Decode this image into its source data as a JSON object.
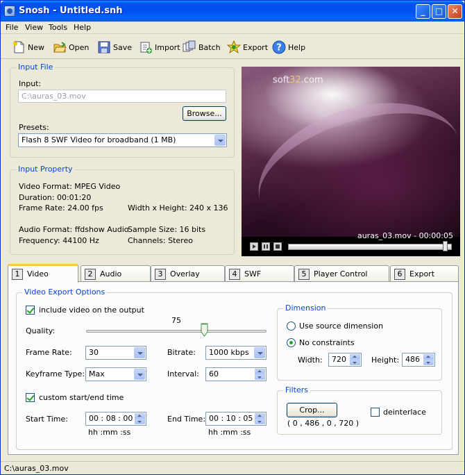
{
  "window": {
    "title": "Snosh - Untitled.snh",
    "min": "_",
    "max": "□",
    "close": "✕"
  },
  "menu": {
    "file": "File",
    "view": "View",
    "tools": "Tools",
    "help": "Help"
  },
  "toolbar": {
    "new": "New",
    "open": "Open",
    "save": "Save",
    "import": "Import",
    "batch": "Batch",
    "export": "Export",
    "help": "Help"
  },
  "input_file": {
    "title": "Input File",
    "input_label": "Input:",
    "input_value": "C:\\auras_03.mov",
    "browse": "Browse...",
    "presets_label": "Presets:",
    "preset_value": "Flash 8 SWF Video for broadband (1 MB)"
  },
  "input_property": {
    "title": "Input Property",
    "video_format": "Video Format: MPEG Video",
    "duration": "Duration: 00:01:20",
    "frame_rate": "Frame Rate: 24.00 fps",
    "dimensions": "Width x Height: 240 x 136",
    "audio_format": "Audio Format: ffdshow Audio",
    "sample_size": "Sample Size: 16 bits",
    "frequency": "Frequency: 44100 Hz",
    "channels": "Channels: Stereo"
  },
  "preview": {
    "watermark_prefix": "soft",
    "watermark_num": "32",
    "watermark_suffix": ".com",
    "caption": "auras_03.mov - 00:00:05",
    "position": 0.96
  },
  "tabs": [
    {
      "num": "1",
      "label": "Video"
    },
    {
      "num": "2",
      "label": "Audio"
    },
    {
      "num": "3",
      "label": "Overlay"
    },
    {
      "num": "4",
      "label": "SWF"
    },
    {
      "num": "5",
      "label": "Player Control"
    },
    {
      "num": "6",
      "label": "Export"
    }
  ],
  "video_export": {
    "title": "Video Export Options",
    "include_video": "include video on the output",
    "quality_label": "Quality:",
    "quality_value": "75",
    "quality_level": 0.75,
    "frame_rate_label": "Frame Rate:",
    "frame_rate_value": "30",
    "bitrate_label": "Bitrate:",
    "bitrate_value": "1000 kbps",
    "keyframe_label": "Keyframe Type:",
    "keyframe_value": "Max",
    "interval_label": "Interval:",
    "interval_value": "60",
    "custom_time": "custom start/end time",
    "start_label": "Start Time:",
    "start_value": "00 : 08 : 00",
    "end_label": "End Time:",
    "end_value": "00 : 10 : 05",
    "time_format": "hh :mm :ss"
  },
  "dimension": {
    "title": "Dimension",
    "use_source": "Use source dimension",
    "no_constraints": "No constraints",
    "width_label": "Width:",
    "width_value": "720",
    "height_label": "Height:",
    "height_value": "486"
  },
  "filters": {
    "title": "Filters",
    "crop": "Crop...",
    "crop_values": "( 0 , 486 , 0 , 720 )",
    "deinterlace": "deinterlace"
  },
  "status": "C:\\auras_03.mov"
}
